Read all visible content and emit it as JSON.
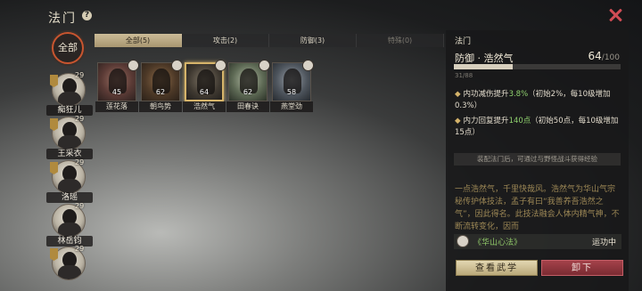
{
  "header": {
    "title": "法门",
    "help_icon": "?"
  },
  "close_icon": "close-icon",
  "sidebar": {
    "all_label": "全部",
    "characters": [
      {
        "name": "痴狂儿",
        "level": "29"
      },
      {
        "name": "王采衣",
        "level": "29"
      },
      {
        "name": "洛瑶",
        "level": "29"
      },
      {
        "name": "林岳钧",
        "level": "29"
      },
      {
        "name": "",
        "level": "29"
      }
    ]
  },
  "tabs": [
    {
      "label": "全部(5)"
    },
    {
      "label": "攻击(2)"
    },
    {
      "label": "防御(3)"
    },
    {
      "label": "特殊(0)"
    }
  ],
  "skills": [
    {
      "name": "莲花落",
      "level": "45"
    },
    {
      "name": "朝鸟势",
      "level": "62"
    },
    {
      "name": "浩然气",
      "level": "64"
    },
    {
      "name": "田春诀",
      "level": "62"
    },
    {
      "name": "燕堂劲",
      "level": "58"
    }
  ],
  "detail": {
    "panel_title": "法门",
    "name": "防御 · 浩然气",
    "level": "64",
    "level_max": "/100",
    "exp": "31/88",
    "exp_fraction": 0.352,
    "effect1_pre": "内功减伤提升",
    "effect1_hi": "3.8%",
    "effect1_post": "（初始2%，每10级增加0.3%）",
    "effect2_pre": "内力回复提升",
    "effect2_hi": "140点",
    "effect2_post": "（初始50点，每10级增加15点）",
    "hint": "装配法门后，可通过与野怪战斗获得经验",
    "lore": "一点浩然气，千里快哉风。浩然气为华山气宗秘传护体技法，孟子有曰“我善养吾浩然之气”，因此得名。此技法融会人体内精气神，不断流转变化，因而",
    "method_name": "《华山心法》",
    "method_status": "运功中",
    "view_button": "查看武学",
    "unload_button": "卸下"
  },
  "colors": {
    "accent_gold": "#d6b46a",
    "highlight_green": "#8fd06e",
    "danger_red": "#d04c55"
  }
}
